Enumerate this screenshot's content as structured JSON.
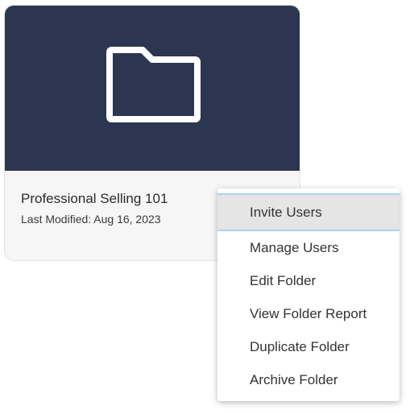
{
  "card": {
    "title": "Professional Selling 101",
    "last_modified": "Last Modified: Aug 16, 2023",
    "thumbnail_icon": "folder-icon",
    "thumbnail_color": "#2c3650"
  },
  "context_menu": {
    "items": [
      {
        "label": "Invite Users",
        "highlighted": true
      },
      {
        "label": "Manage Users"
      },
      {
        "label": "Edit Folder"
      },
      {
        "label": "View Folder Report"
      },
      {
        "label": "Duplicate Folder"
      },
      {
        "label": "Archive Folder"
      }
    ],
    "highlight_color": "#e5e5e5",
    "highlight_border_color": "#a9d4f0"
  }
}
